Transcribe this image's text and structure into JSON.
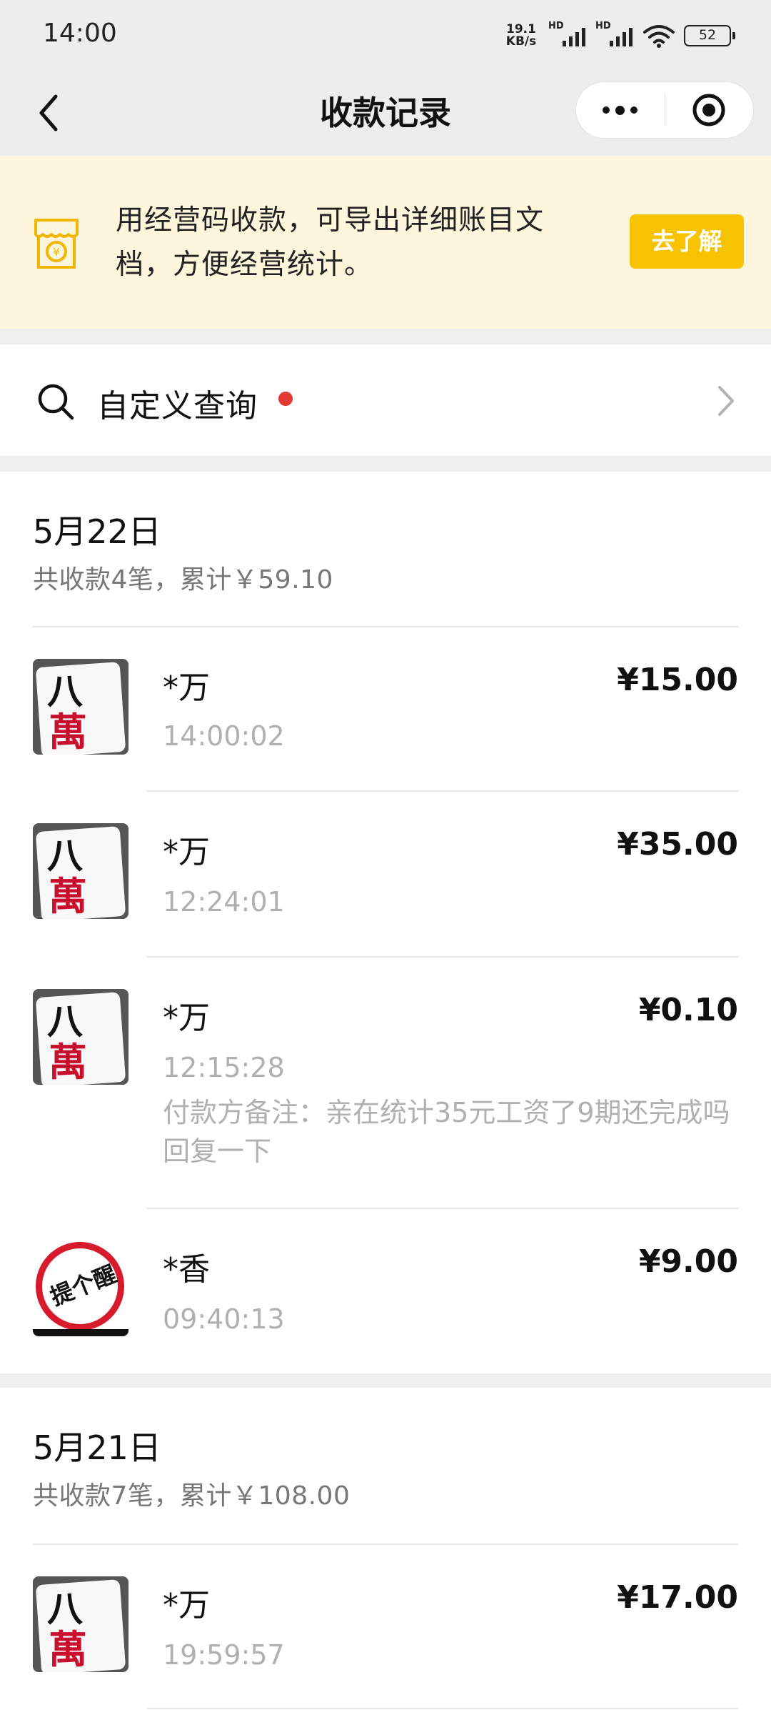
{
  "status_bar": {
    "time": "14:00",
    "net_speed_value": "19.1",
    "net_speed_unit": "KB/s",
    "sim1_tag": "HD",
    "sim2_tag": "HD",
    "battery": "52"
  },
  "nav": {
    "title": "收款记录"
  },
  "banner": {
    "text": "用经营码收款，可导出详细账目文档，方便经营统计。",
    "button": "去了解",
    "accent_color": "#f7c200"
  },
  "query": {
    "label": "自定义查询"
  },
  "days": [
    {
      "date": "5月22日",
      "summary": "共收款4笔，累计￥59.10",
      "records": [
        {
          "payer": "*万",
          "amount": "¥15.00",
          "time": "14:00:02",
          "avatar": "mahjong-tile"
        },
        {
          "payer": "*万",
          "amount": "¥35.00",
          "time": "12:24:01",
          "avatar": "mahjong-tile"
        },
        {
          "payer": "*万",
          "amount": "¥0.10",
          "time": "12:15:28",
          "note": "付款方备注：亲在统计35元工资了9期还完成吗回复一下",
          "avatar": "mahjong-tile"
        },
        {
          "payer": "*香",
          "amount": "¥9.00",
          "time": "09:40:13",
          "avatar": "remind-badge"
        }
      ]
    },
    {
      "date": "5月21日",
      "summary": "共收款7笔，累计￥108.00",
      "records": [
        {
          "payer": "*万",
          "amount": "¥17.00",
          "time": "19:59:57",
          "avatar": "mahjong-tile"
        }
      ]
    }
  ],
  "avatar_art": {
    "tile_top": "八",
    "tile_bottom": "萬",
    "remind_text": "提个醒"
  }
}
